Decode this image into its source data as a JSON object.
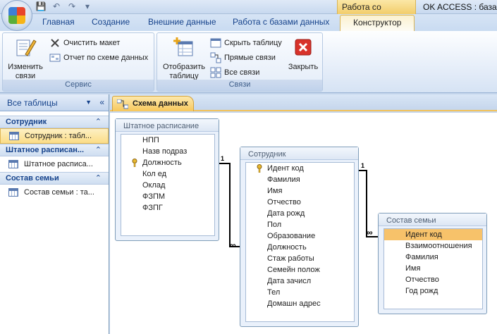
{
  "window": {
    "context_tab_group": "Работа со связями",
    "app_title": "OK ACCESS : база д"
  },
  "tabs": [
    {
      "label": "Главная"
    },
    {
      "label": "Создание"
    },
    {
      "label": "Внешние данные"
    },
    {
      "label": "Работа с базами данных"
    },
    {
      "label": "Конструктор"
    }
  ],
  "ribbon": {
    "groups": {
      "service": {
        "label": "Сервис",
        "edit_relations": "Изменить связи",
        "clear_layout": "Очистить макет",
        "relationship_report": "Отчет по схеме данных"
      },
      "relations": {
        "label": "Связи",
        "show_table": "Отобразить таблицу",
        "hide_table": "Скрыть таблицу",
        "direct_relations": "Прямые связи",
        "all_relations": "Все связи",
        "close": "Закрыть"
      }
    }
  },
  "nav": {
    "header": "Все таблицы",
    "sections": [
      {
        "title": "Сотрудник",
        "item": "Сотрудник : табл..."
      },
      {
        "title": "Штатное расписан...",
        "item": "Штатное расписа..."
      },
      {
        "title": "Состав семьи",
        "item": "Состав семьи : та..."
      }
    ]
  },
  "doc_tab": "Схема данных",
  "tables": {
    "shtat": {
      "title": "Штатное расписание",
      "fields": [
        "НПП",
        "Назв подраз",
        "Должность",
        "Кол ед",
        "Оклад",
        "ФЗПМ",
        "ФЗПГ"
      ]
    },
    "sotrudnik": {
      "title": "Сотрудник",
      "fields": [
        "Идент код",
        "Фамилия",
        "Имя",
        "Отчество",
        "Дата рожд",
        "Пол",
        "Образование",
        "Должность",
        "Стаж работы",
        "Семейн полож",
        "Дата зачисл",
        "Тел",
        "Домашн адрес"
      ]
    },
    "sostav": {
      "title": "Состав семьи",
      "fields": [
        "Идент код",
        "Взаимоотношения",
        "Фамилия",
        "Имя",
        "Отчество",
        "Год рожд"
      ]
    }
  },
  "relations": {
    "one_label": "1",
    "many_label": "∞"
  }
}
